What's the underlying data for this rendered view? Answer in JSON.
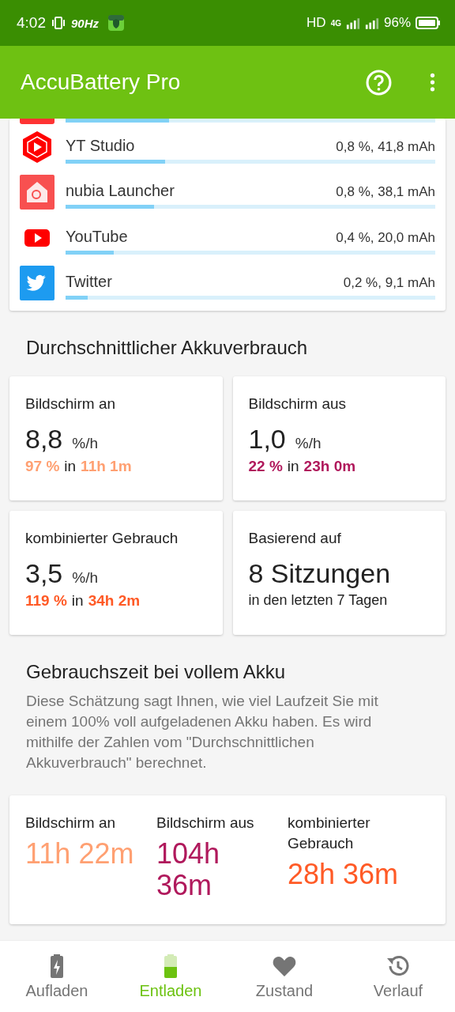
{
  "status_bar": {
    "time": "4:02",
    "refresh": "90Hz",
    "network": "HD",
    "mobile": "4G",
    "battery": "96%"
  },
  "app_bar": {
    "title": "AccuBattery Pro"
  },
  "apps": {
    "cut_row": {
      "level": 0.28
    },
    "rows": [
      {
        "name": "YT Studio",
        "usage": "0,8 %, 41,8 mAh",
        "level": 0.27
      },
      {
        "name": "nubia Launcher",
        "usage": "0,8 %, 38,1 mAh",
        "level": 0.24
      },
      {
        "name": "YouTube",
        "usage": "0,4 %, 20,0 mAh",
        "level": 0.13
      },
      {
        "name": "Twitter",
        "usage": "0,2 %, 9,1 mAh",
        "level": 0.06
      }
    ]
  },
  "average": {
    "title": "Durchschnittlicher Akkuverbrauch",
    "cards": [
      {
        "kind": "rate",
        "label": "Bildschirm an",
        "value": "8,8",
        "unit": "%/h",
        "percent": "97 %",
        "in": "in",
        "time": "11h 1m",
        "color": "#ffa072"
      },
      {
        "kind": "rate",
        "label": "Bildschirm aus",
        "value": "1,0",
        "unit": "%/h",
        "percent": "22 %",
        "in": "in",
        "time": "23h 0m",
        "color": "#b0195c"
      },
      {
        "kind": "rate",
        "label": "kombinierter Gebrauch",
        "value": "3,5",
        "unit": "%/h",
        "percent": "119 %",
        "in": "in",
        "time": "34h 2m",
        "color": "#ff5a26"
      },
      {
        "kind": "sessions",
        "label": "Basierend auf",
        "value": "8 Sitzungen",
        "note": "in den letzten 7 Tagen"
      }
    ]
  },
  "full_charge": {
    "title": "Gebrauchszeit bei vollem Akku",
    "description": "Diese Schätzung sagt Ihnen, wie viel Laufzeit Sie mit einem 100% voll aufgeladenen Akku haben. Es wird mithilfe der Zahlen vom \"Durchschnittlichen Akkuverbrauch\" berechnet.",
    "columns": [
      {
        "label": "Bildschirm an",
        "value": "11h 22m",
        "color": "#ffa072"
      },
      {
        "label": "Bildschirm aus",
        "value": "104h 36m",
        "color": "#b0195c"
      },
      {
        "label": "kombinierter Gebrauch",
        "value": "28h 36m",
        "color": "#ff5a26"
      }
    ]
  },
  "bottom_nav": [
    {
      "label": "Aufladen",
      "selected": false
    },
    {
      "label": "Entladen",
      "selected": true
    },
    {
      "label": "Zustand",
      "selected": false
    },
    {
      "label": "Verlauf",
      "selected": false
    }
  ]
}
